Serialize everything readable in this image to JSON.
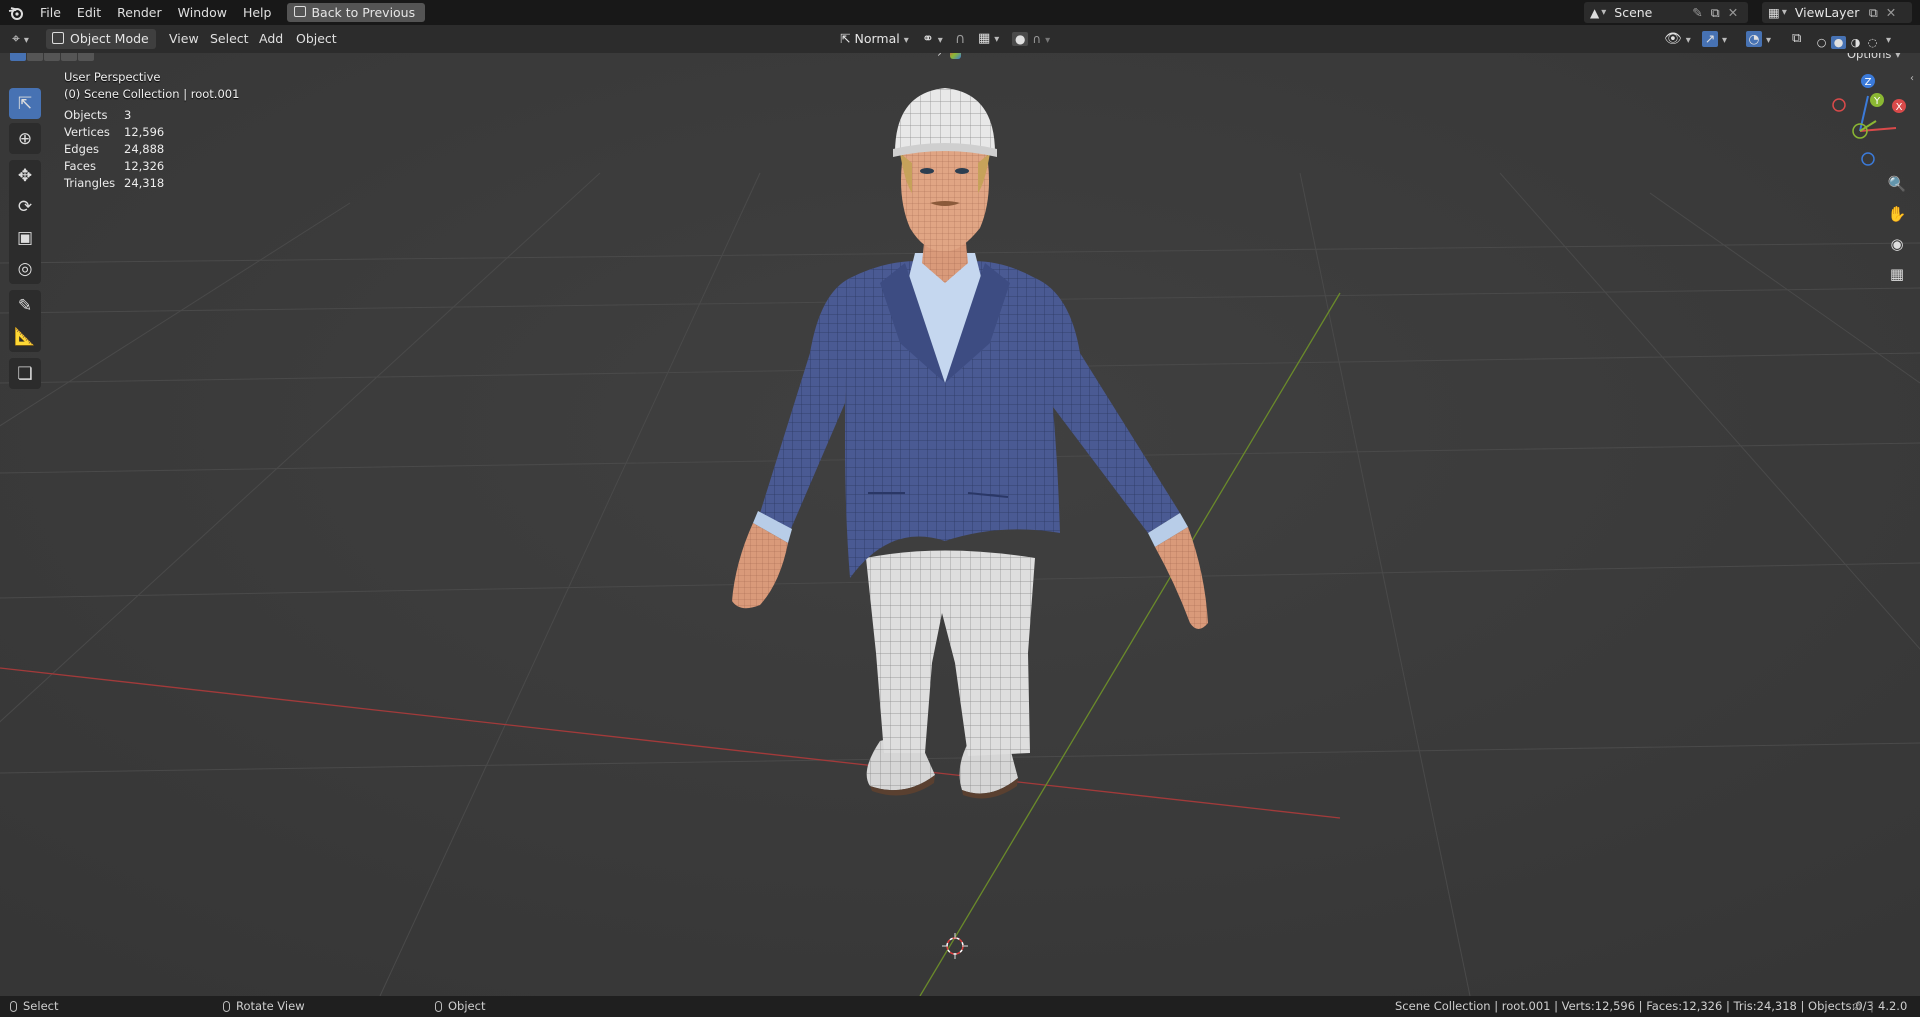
{
  "menu": {
    "items": [
      "File",
      "Edit",
      "Render",
      "Window",
      "Help"
    ],
    "back_button": "Back to Previous"
  },
  "scene_selector": {
    "value": "Scene"
  },
  "viewlayer_selector": {
    "value": "ViewLayer"
  },
  "header": {
    "mode": "Object Mode",
    "menus": [
      "View",
      "Select",
      "Add",
      "Object"
    ],
    "orientation": "Normal",
    "options_label": "Options"
  },
  "viewport": {
    "view_name": "User Perspective",
    "collection": "(0) Scene Collection | root.001",
    "stats": [
      {
        "label": "Objects",
        "value": "3"
      },
      {
        "label": "Vertices",
        "value": "12,596"
      },
      {
        "label": "Edges",
        "value": "24,888"
      },
      {
        "label": "Faces",
        "value": "12,326"
      },
      {
        "label": "Triangles",
        "value": "24,318"
      }
    ],
    "gizmo": {
      "z": "Z",
      "y": "Y",
      "x": "X"
    }
  },
  "statusbar": {
    "select": "Select",
    "rotate": "Rotate View",
    "object": "Object",
    "info": "Scene Collection | root.001 | Verts:12,596 | Faces:12,326 | Tris:24,318 | Objects:0/3",
    "version": "4.2.0"
  },
  "colors": {
    "accent": "#4772b3",
    "x_axis": "#c0392b",
    "y_axis": "#7fa82e",
    "jacket": "#4a5a93"
  },
  "icons": [
    "blender-logo",
    "select-box-icon",
    "cursor-icon",
    "move-icon",
    "rotate-icon",
    "scale-icon",
    "transform-icon",
    "annotate-icon",
    "measure-icon",
    "add-cube-icon",
    "zoom-icon",
    "hand-icon",
    "camera-icon",
    "grid-icon"
  ]
}
